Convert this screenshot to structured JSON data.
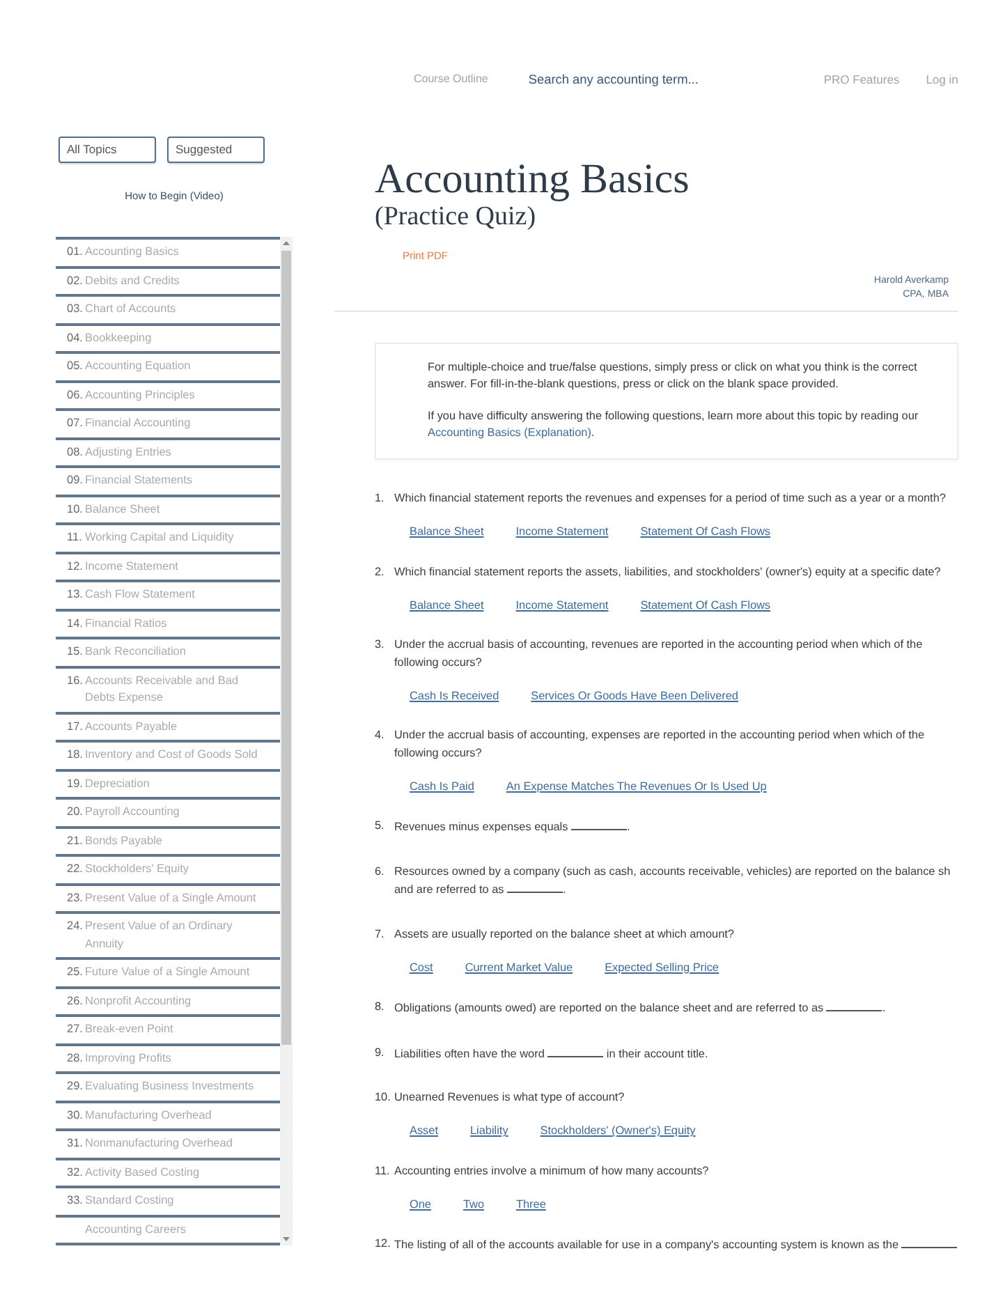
{
  "top_nav": {
    "course_outline": "Course Outline",
    "search": {
      "placeholder": "Search any accounting term..."
    },
    "pro_features": "PRO Features",
    "log_in": "Log in"
  },
  "sidebar": {
    "filters": [
      "All Topics",
      "Suggested"
    ],
    "video_link": "How to Begin (Video)",
    "topics": [
      {
        "number": "01.",
        "title": "Accounting Basics"
      },
      {
        "number": "02.",
        "title": "Debits and Credits"
      },
      {
        "number": "03.",
        "title": "Chart of Accounts"
      },
      {
        "number": "04.",
        "title": "Bookkeeping"
      },
      {
        "number": "05.",
        "title": "Accounting Equation"
      },
      {
        "number": "06.",
        "title": "Accounting Principles"
      },
      {
        "number": "07.",
        "title": "Financial Accounting"
      },
      {
        "number": "08.",
        "title": "Adjusting Entries"
      },
      {
        "number": "09.",
        "title": "Financial Statements"
      },
      {
        "number": "10.",
        "title": "Balance Sheet"
      },
      {
        "number": "11.",
        "title": "Working Capital and Liquidity"
      },
      {
        "number": "12.",
        "title": "Income Statement"
      },
      {
        "number": "13.",
        "title": "Cash Flow Statement"
      },
      {
        "number": "14.",
        "title": "Financial Ratios"
      },
      {
        "number": "15.",
        "title": "Bank Reconciliation"
      },
      {
        "number": "16.",
        "title": "Accounts Receivable and Bad Debts Expense"
      },
      {
        "number": "17.",
        "title": "Accounts Payable"
      },
      {
        "number": "18.",
        "title": "Inventory and Cost of Goods Sold"
      },
      {
        "number": "19.",
        "title": "Depreciation"
      },
      {
        "number": "20.",
        "title": "Payroll Accounting"
      },
      {
        "number": "21.",
        "title": "Bonds Payable"
      },
      {
        "number": "22.",
        "title": "Stockholders' Equity"
      },
      {
        "number": "23.",
        "title": "Present Value of a Single Amount"
      },
      {
        "number": "24.",
        "title": "Present Value of an Ordinary Annuity"
      },
      {
        "number": "25.",
        "title": "Future Value of a Single Amount"
      },
      {
        "number": "26.",
        "title": "Nonprofit Accounting"
      },
      {
        "number": "27.",
        "title": "Break-even Point"
      },
      {
        "number": "28.",
        "title": "Improving Profits"
      },
      {
        "number": "29.",
        "title": "Evaluating Business Investments"
      },
      {
        "number": "30.",
        "title": "Manufacturing Overhead"
      },
      {
        "number": "31.",
        "title": "Nonmanufacturing Overhead"
      },
      {
        "number": "32.",
        "title": "Activity Based Costing"
      },
      {
        "number": "33.",
        "title": "Standard Costing"
      },
      {
        "title": "Accounting Careers"
      }
    ]
  },
  "header": {
    "title": "Accounting Basics",
    "subtitle": "(Practice Quiz)",
    "print_link": "Print PDF",
    "author": [
      "Harold Averkamp",
      "CPA, MBA"
    ]
  },
  "instructions": {
    "paragraphs": [
      {
        "text": "For multiple-choice and true/false questions, simply press or click on what you think is the correct answer. For fill-in-the-blank questions, press or click on the blank space provided."
      },
      {
        "text": "If you have difficulty answering the following questions, learn more about this topic by reading our",
        "link": "Accounting Basics (Explanation)",
        "after": "."
      }
    ]
  },
  "questions": [
    {
      "number": "1.",
      "kind": "choice",
      "text": "Which financial statement reports the revenues and expenses for a period of time such as a year or a month?",
      "answers": [
        "Balance Sheet",
        "Income Statement",
        "Statement Of Cash Flows"
      ]
    },
    {
      "number": "2.",
      "kind": "choice",
      "text": "Which financial statement reports the assets, liabilities, and stockholders' (owner's) equity at a specific date?",
      "answers": [
        "Balance Sheet",
        "Income Statement",
        "Statement Of Cash Flows"
      ]
    },
    {
      "number": "3.",
      "kind": "choice",
      "text": "Under the accrual basis of accounting, revenues are reported in the accounting period when which of the following occurs?",
      "answers": [
        "Cash Is Received",
        "Services Or Goods Have Been Delivered"
      ]
    },
    {
      "number": "4.",
      "kind": "choice",
      "text": "Under the accrual basis of accounting, expenses are reported in the accounting period when which of the following occurs?",
      "answers": [
        "Cash Is Paid",
        "An Expense Matches The Revenues Or Is Used Up"
      ]
    },
    {
      "number": "5.",
      "kind": "fill_in",
      "text": "Revenues minus expenses equals",
      "after": "."
    },
    {
      "number": "6.",
      "kind": "fill_in",
      "text": "Resources owned by a company (such as cash, accounts receivable, vehicles) are reported on the balance sh and are referred to as",
      "after": "."
    },
    {
      "number": "7.",
      "kind": "choice",
      "text": "Assets are usually reported on the balance sheet at which amount?",
      "answers": [
        "Cost",
        "Current Market Value",
        "Expected Selling Price"
      ]
    },
    {
      "number": "8.",
      "kind": "fill_in",
      "text": "Obligations (amounts owed) are reported on the balance sheet and are referred to as",
      "after": "."
    },
    {
      "number": "9.",
      "kind": "fill_in",
      "text": "Liabilities often have the word",
      "after": "in their account title."
    },
    {
      "number": "10.",
      "kind": "choice",
      "text": "Unearned Revenues is what type of account?",
      "answers": [
        "Asset",
        "Liability",
        "Stockholders' (Owner's) Equity"
      ]
    },
    {
      "number": "11.",
      "kind": "choice",
      "text": "Accounting entries involve a minimum of how many accounts?",
      "answers": [
        "One",
        "Two",
        "Three"
      ]
    },
    {
      "number": "12.",
      "kind": "fill_in",
      "text": "The listing of all of the accounts available for use in a company's accounting system is known as the"
    }
  ]
}
